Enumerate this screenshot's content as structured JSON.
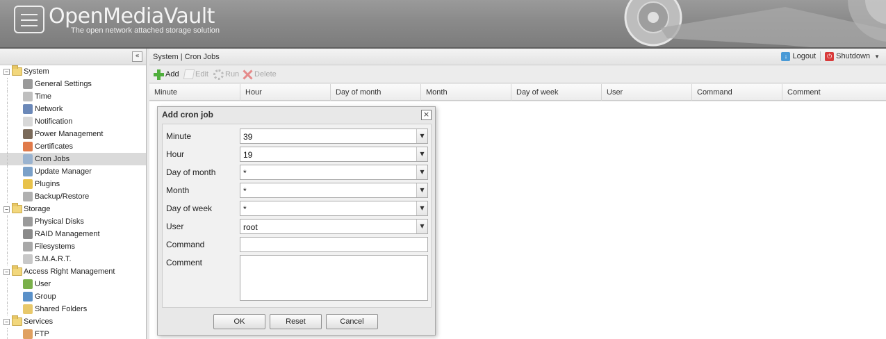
{
  "header": {
    "app_title": "OpenMediaVault",
    "tagline": "The open network attached storage solution"
  },
  "sidebar": {
    "collapse_icon": "double-chevron-left-icon",
    "items": [
      {
        "type": "category",
        "label": "System",
        "expanded": true
      },
      {
        "type": "item",
        "label": "General Settings",
        "icon": "tools-icon",
        "color": "#9a9a9a"
      },
      {
        "type": "item",
        "label": "Time",
        "icon": "clock-icon",
        "color": "#bfbfbf"
      },
      {
        "type": "item",
        "label": "Network",
        "icon": "network-icon",
        "color": "#6b88b8"
      },
      {
        "type": "item",
        "label": "Notification",
        "icon": "note-icon",
        "color": "#d8d8d8"
      },
      {
        "type": "item",
        "label": "Power Management",
        "icon": "power-plug-icon",
        "color": "#7a6a5a"
      },
      {
        "type": "item",
        "label": "Certificates",
        "icon": "certificate-icon",
        "color": "#e07a4a"
      },
      {
        "type": "item",
        "label": "Cron Jobs",
        "icon": "cron-clock-icon",
        "color": "#9ab3cf",
        "selected": true
      },
      {
        "type": "item",
        "label": "Update Manager",
        "icon": "update-globe-icon",
        "color": "#7aa0c8"
      },
      {
        "type": "item",
        "label": "Plugins",
        "icon": "puzzle-icon",
        "color": "#e8c24a"
      },
      {
        "type": "item",
        "label": "Backup/Restore",
        "icon": "gear-icon",
        "color": "#b0b0b0"
      },
      {
        "type": "category",
        "label": "Storage",
        "expanded": true
      },
      {
        "type": "item",
        "label": "Physical Disks",
        "icon": "disk-icon",
        "color": "#9a9a9a"
      },
      {
        "type": "item",
        "label": "RAID Management",
        "icon": "raid-icon",
        "color": "#8a8a8a"
      },
      {
        "type": "item",
        "label": "Filesystems",
        "icon": "filesystem-icon",
        "color": "#a8a8a8"
      },
      {
        "type": "item",
        "label": "S.M.A.R.T.",
        "icon": "smart-icon",
        "color": "#c8c8c8"
      },
      {
        "type": "category",
        "label": "Access Right Management",
        "expanded": true
      },
      {
        "type": "item",
        "label": "User",
        "icon": "user-icon",
        "color": "#7ab04a"
      },
      {
        "type": "item",
        "label": "Group",
        "icon": "group-icon",
        "color": "#5a90c8"
      },
      {
        "type": "item",
        "label": "Shared Folders",
        "icon": "shared-folder-icon",
        "color": "#e8c86a"
      },
      {
        "type": "category",
        "label": "Services",
        "expanded": true
      },
      {
        "type": "item",
        "label": "FTP",
        "icon": "ftp-icon",
        "color": "#e0a060"
      }
    ]
  },
  "main": {
    "breadcrumb": "System | Cron Jobs",
    "logout_label": "Logout",
    "shutdown_label": "Shutdown",
    "toolbar": {
      "add_label": "Add",
      "edit_label": "Edit",
      "run_label": "Run",
      "delete_label": "Delete"
    },
    "columns": [
      "Minute",
      "Hour",
      "Day of month",
      "Month",
      "Day of week",
      "User",
      "Command",
      "Comment"
    ]
  },
  "dialog": {
    "title": "Add cron job",
    "fields": {
      "minute_label": "Minute",
      "minute_value": "39",
      "hour_label": "Hour",
      "hour_value": "19",
      "dom_label": "Day of month",
      "dom_value": "*",
      "month_label": "Month",
      "month_value": "*",
      "dow_label": "Day of week",
      "dow_value": "*",
      "user_label": "User",
      "user_value": "root",
      "command_label": "Command",
      "command_value": "",
      "comment_label": "Comment",
      "comment_value": ""
    },
    "ok_label": "OK",
    "reset_label": "Reset",
    "cancel_label": "Cancel"
  }
}
